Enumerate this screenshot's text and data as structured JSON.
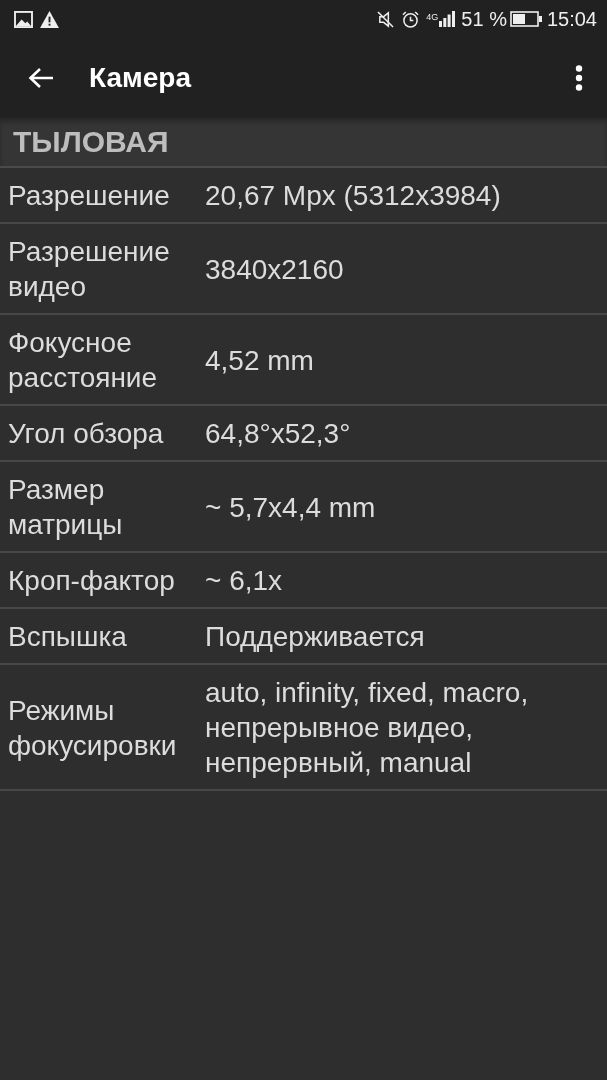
{
  "status_bar": {
    "network": "4G",
    "battery": "51 %",
    "time": "15:04"
  },
  "app_bar": {
    "title": "Камера"
  },
  "section": {
    "title": "ТЫЛОВАЯ",
    "rows": [
      {
        "label": "Разрешение",
        "value": "20,67 Mpx (5312x3984)"
      },
      {
        "label": "Разрешение видео",
        "value": "3840x2160"
      },
      {
        "label": "Фокусное расстояние",
        "value": "4,52 mm"
      },
      {
        "label": "Угол обзора",
        "value": "64,8°x52,3°"
      },
      {
        "label": "Размер матрицы",
        "value": "~ 5,7x4,4 mm"
      },
      {
        "label": "Кроп-фактор",
        "value": "~ 6,1x"
      },
      {
        "label": "Вспышка",
        "value": "Поддерживается"
      },
      {
        "label": "Режимы фокусировки",
        "value": "auto, infinity, fixed, macro, непрерывное видео, непрервный, manual"
      }
    ]
  }
}
